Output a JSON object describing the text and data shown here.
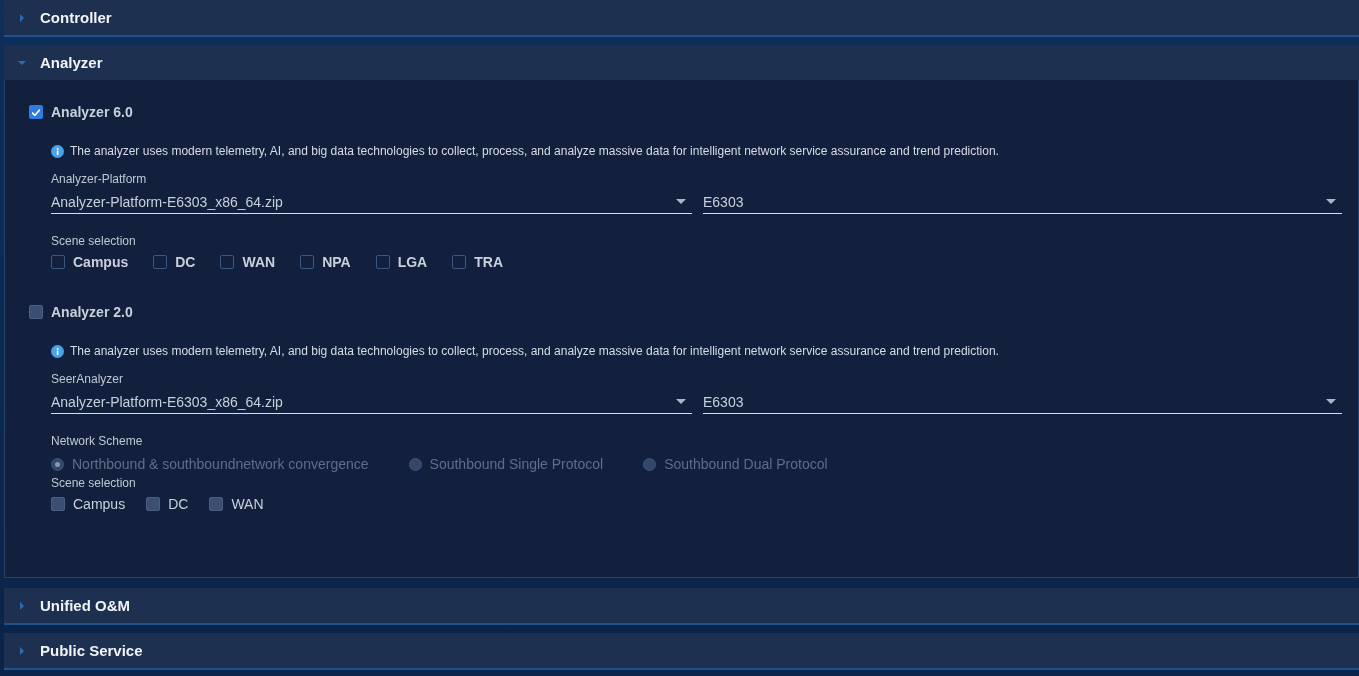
{
  "sections": [
    {
      "title": "Controller",
      "expanded": false
    },
    {
      "title": "Analyzer",
      "expanded": true,
      "products": [
        {
          "name": "Analyzer 6.0",
          "checked": true,
          "disabled": false,
          "info": "The analyzer uses modern telemetry, AI, and big data technologies to collect, process, and analyze massive data for intelligent network service assurance and trend prediction.",
          "package_label": "Analyzer-Platform",
          "package_value": "Analyzer-Platform-E6303_x86_64.zip",
          "version_value": "E6303",
          "scene_label": "Scene selection",
          "scenes": [
            {
              "label": "Campus",
              "checked": false,
              "disabled": false
            },
            {
              "label": "DC",
              "checked": false,
              "disabled": false
            },
            {
              "label": "WAN",
              "checked": false,
              "disabled": false
            },
            {
              "label": "NPA",
              "checked": false,
              "disabled": false
            },
            {
              "label": "LGA",
              "checked": false,
              "disabled": false
            },
            {
              "label": "TRA",
              "checked": false,
              "disabled": false
            }
          ]
        },
        {
          "name": "Analyzer 2.0",
          "checked": false,
          "disabled": true,
          "info": "The analyzer uses modern telemetry, AI, and big data technologies to collect, process, and analyze massive data for intelligent network service assurance and trend prediction.",
          "package_label": "SeerAnalyzer",
          "package_value": "Analyzer-Platform-E6303_x86_64.zip",
          "version_value": "E6303",
          "scheme_label": "Network Scheme",
          "schemes": [
            {
              "label": "Northbound & southboundnetwork convergence",
              "selected": true,
              "disabled": true
            },
            {
              "label": "Southbound Single Protocol",
              "selected": false,
              "disabled": true
            },
            {
              "label": "Southbound Dual Protocol",
              "selected": false,
              "disabled": true
            }
          ],
          "scene_label": "Scene selection",
          "scenes": [
            {
              "label": "Campus",
              "checked": false,
              "disabled": true
            },
            {
              "label": "DC",
              "checked": false,
              "disabled": true
            },
            {
              "label": "WAN",
              "checked": false,
              "disabled": true
            }
          ]
        }
      ]
    },
    {
      "title": "Unified O&M",
      "expanded": false
    },
    {
      "title": "Public Service",
      "expanded": false
    }
  ]
}
